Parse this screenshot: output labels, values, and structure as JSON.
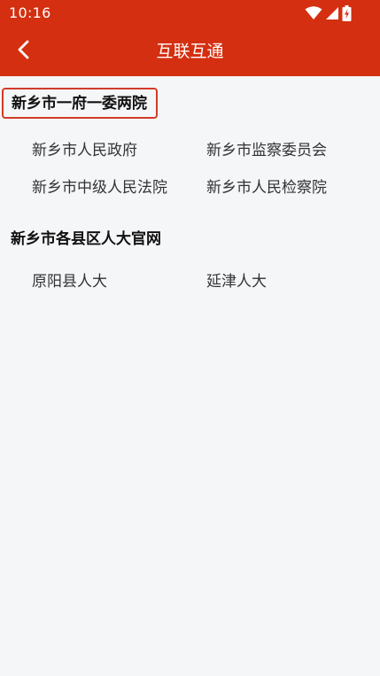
{
  "status_bar": {
    "time": "10:16",
    "icons": [
      "wifi-icon",
      "signal-icon",
      "battery-charging-icon"
    ]
  },
  "header": {
    "title": "互联互通",
    "back_icon": "chevron-left-icon"
  },
  "sections": [
    {
      "title": "新乡市一府一委两院",
      "highlighted": true,
      "links": [
        "新乡市人民政府",
        "新乡市监察委员会",
        "新乡市中级人民法院",
        "新乡市人民检察院"
      ]
    },
    {
      "title": "新乡市各县区人大官网",
      "highlighted": false,
      "links": [
        "原阳县人大",
        "延津人大"
      ]
    }
  ],
  "colors": {
    "header_bg": "#d42f10",
    "highlight_border": "#d33b2a",
    "page_bg": "#f5f6f8"
  }
}
